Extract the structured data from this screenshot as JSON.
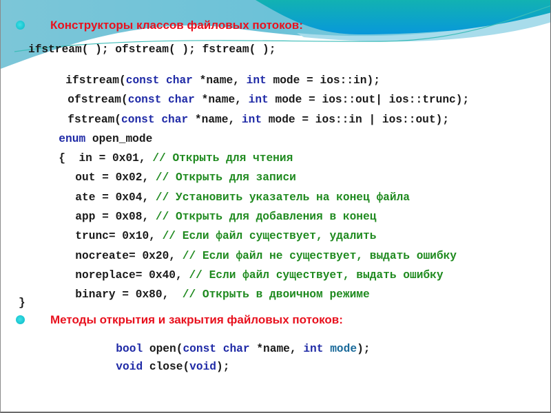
{
  "slide": {
    "colors": {
      "heading": "#e8111e",
      "bullet": "#17c4cf",
      "keyword": "#1f2aa6",
      "comment": "#1f8a1f",
      "code": "#1a1a1a",
      "banner_dark": "#0a9ad6",
      "banner_teal": "#11b3b7",
      "banner_light": "#8fd3e4"
    },
    "section1": {
      "title": "Конструкторы классов файловых потоков:",
      "line1": "ifstream( ); ofstream( ); fstream( );",
      "ctor_ifstream": {
        "name": "ifstream(",
        "kw1": "const",
        "kw2": "char",
        "mid": " *name, ",
        "kw3": "int",
        "rest": " mode = ios::in);"
      },
      "ctor_ofstream": {
        "name": "ofstream(",
        "kw1": "const",
        "kw2": "char",
        "mid": " *name, ",
        "kw3": "int",
        "rest": " mode = ios::out| ios::trunc);"
      },
      "ctor_fstream": {
        "name": "fstream(",
        "kw1": "const",
        "kw2": "char",
        "mid": " *name, ",
        "kw3": "int",
        "rest": " mode = ios::in | ios::out);"
      }
    },
    "enum": {
      "keyword": "enum",
      "name": " open_mode",
      "open_brace": "{",
      "close_brace": "}",
      "members": [
        {
          "code": "in = 0x01, ",
          "comment": "// Открыть для чтения"
        },
        {
          "code": "out = 0x02, ",
          "comment": "// Открыть для записи"
        },
        {
          "code": "ate = 0x04, ",
          "comment": "// Установить указатель на конец файла"
        },
        {
          "code": "app = 0x08, ",
          "comment": "// Открыть для добавления в конец"
        },
        {
          "code": "trunc= 0x10, ",
          "comment": "// Если файл существует, удалить"
        },
        {
          "code": "nocreate= 0x20, ",
          "comment": "// Если файл не существует, выдать ошибку"
        },
        {
          "code": "noreplace= 0x40, ",
          "comment": "// Если файл существует, выдать ошибку"
        },
        {
          "code": "binary = 0x80,  ",
          "comment": "// Открыть в двоичном режиме"
        }
      ]
    },
    "section2": {
      "title": "Методы открытия и закрытия файловых потоков:",
      "open": {
        "kw_bool": "bool",
        "name": " open(",
        "kw1": "const",
        "kw2": "char",
        "mid": " *name, ",
        "kw3": "int",
        "param": "mode",
        "rest": ");"
      },
      "close": {
        "kw_void": "void",
        "name": " close(",
        "kw_void2": "void",
        "rest": ");"
      }
    }
  }
}
